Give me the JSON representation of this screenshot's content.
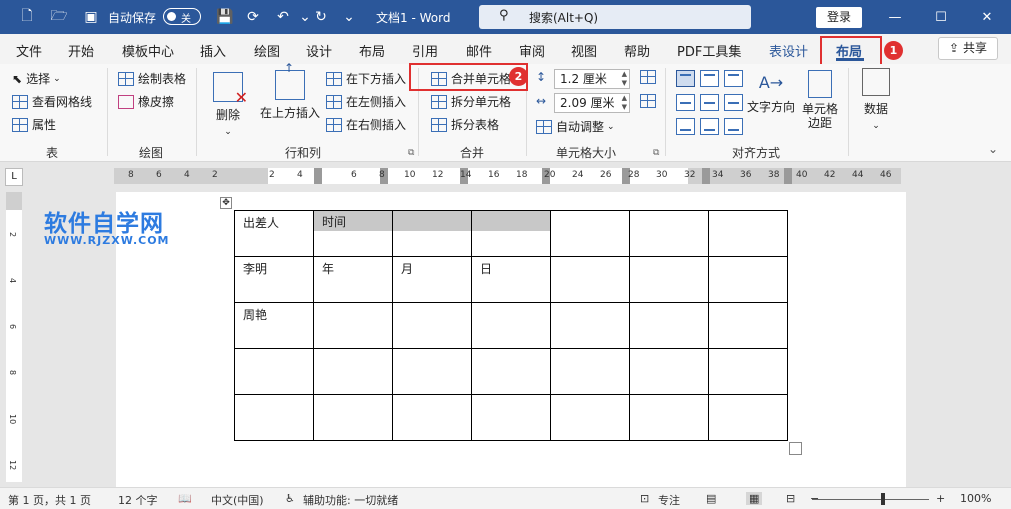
{
  "titlebar": {
    "autosave_label": "自动保存",
    "autosave_state": "关",
    "doc_title": "文档1 - Word",
    "search_placeholder": "搜索(Alt+Q)",
    "login_label": "登录"
  },
  "tabs": {
    "items": [
      "文件",
      "开始",
      "模板中心",
      "插入",
      "绘图",
      "设计",
      "布局",
      "引用",
      "邮件",
      "审阅",
      "视图",
      "帮助",
      "PDF工具集"
    ],
    "table_design": "表设计",
    "layout_active": "布局",
    "share": "共享"
  },
  "annotations": {
    "badge1": "1",
    "badge2": "2"
  },
  "ribbon": {
    "table": {
      "select": "选择",
      "view_gridlines": "查看网格线",
      "properties": "属性",
      "label": "表"
    },
    "draw": {
      "draw_table": "绘制表格",
      "eraser": "橡皮擦",
      "label": "绘图"
    },
    "rows_cols": {
      "delete": "删除",
      "insert_above": "在上方插入",
      "insert_below": "在下方插入",
      "insert_left": "在左侧插入",
      "insert_right": "在右侧插入",
      "label": "行和列"
    },
    "merge": {
      "merge_cells": "合并单元格",
      "split_cells": "拆分单元格",
      "split_table": "拆分表格",
      "label": "合并"
    },
    "cell_size": {
      "height": "1.2 厘米",
      "width": "2.09 厘米",
      "autofit": "自动调整",
      "label": "单元格大小"
    },
    "alignment": {
      "text_direction": "文字方向",
      "cell_margins": "单元格边距",
      "label": "对齐方式"
    },
    "data": {
      "label": "数据"
    }
  },
  "ruler": {
    "h_ticks": [
      "8",
      "6",
      "4",
      "2",
      "2",
      "4",
      "6",
      "8",
      "10",
      "12",
      "14",
      "16",
      "18",
      "20",
      "24",
      "26",
      "28",
      "30",
      "32",
      "34",
      "36",
      "38",
      "40",
      "42",
      "44",
      "46"
    ],
    "v_ticks": [
      "2",
      "4",
      "6",
      "8",
      "10",
      "12"
    ]
  },
  "watermark": {
    "name": "软件自学网",
    "url": "WWW.RJZXW.COM"
  },
  "table": {
    "rows": [
      [
        "出差人",
        "时间",
        "",
        "",
        "",
        "",
        ""
      ],
      [
        "李明",
        "年",
        "月",
        "日",
        "",
        "",
        ""
      ],
      [
        "周艳",
        "",
        "",
        "",
        "",
        "",
        ""
      ],
      [
        "",
        "",
        "",
        "",
        "",
        "",
        ""
      ],
      [
        "",
        "",
        "",
        "",
        "",
        "",
        ""
      ]
    ]
  },
  "statusbar": {
    "page": "第 1 页，共 1 页",
    "words": "12 个字",
    "language": "中文(中国)",
    "accessibility": "辅助功能: 一切就绪",
    "focus": "专注",
    "zoom": "100%"
  }
}
